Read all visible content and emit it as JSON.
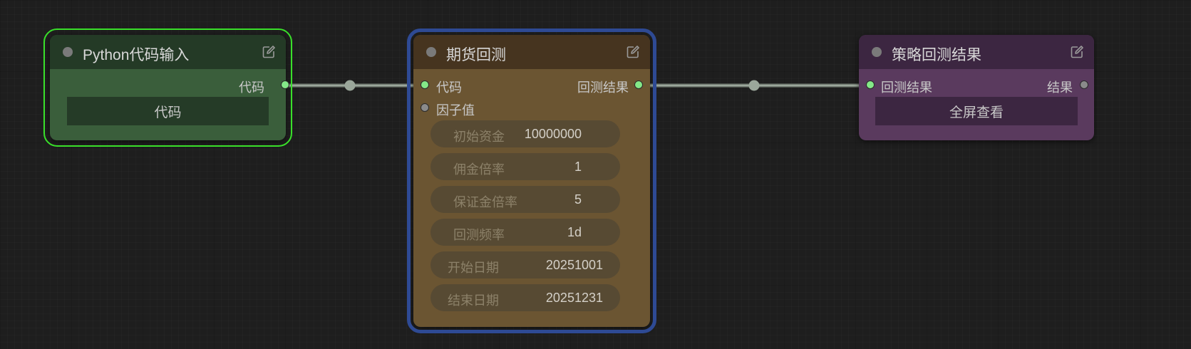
{
  "colors": {
    "connected_port": "#84e888",
    "idle_port": "#8a8a8a",
    "link": "#9ba79b",
    "selected_outline": "#39e02a",
    "group_outline": "#2e4a94"
  },
  "nodes": {
    "python_input": {
      "title": "Python代码输入",
      "output_label": "代码",
      "button_label": "代码",
      "icon": "edit-icon"
    },
    "futures_backtest": {
      "title": "期货回测",
      "input_code_label": "代码",
      "input_factor_label": "因子值",
      "output_label": "回测结果",
      "icon": "edit-icon",
      "params": [
        {
          "label": "初始资金",
          "value": "10000000"
        },
        {
          "label": "佣金倍率",
          "value": "1"
        },
        {
          "label": "保证金倍率",
          "value": "5"
        },
        {
          "label": "回测频率",
          "value": "1d"
        },
        {
          "label": "开始日期",
          "value": "20251001"
        },
        {
          "label": "结束日期",
          "value": "20251231"
        }
      ]
    },
    "strategy_result": {
      "title": "策略回测结果",
      "input_label": "回测结果",
      "output_label": "结果",
      "button_label": "全屏查看",
      "icon": "edit-icon"
    }
  }
}
